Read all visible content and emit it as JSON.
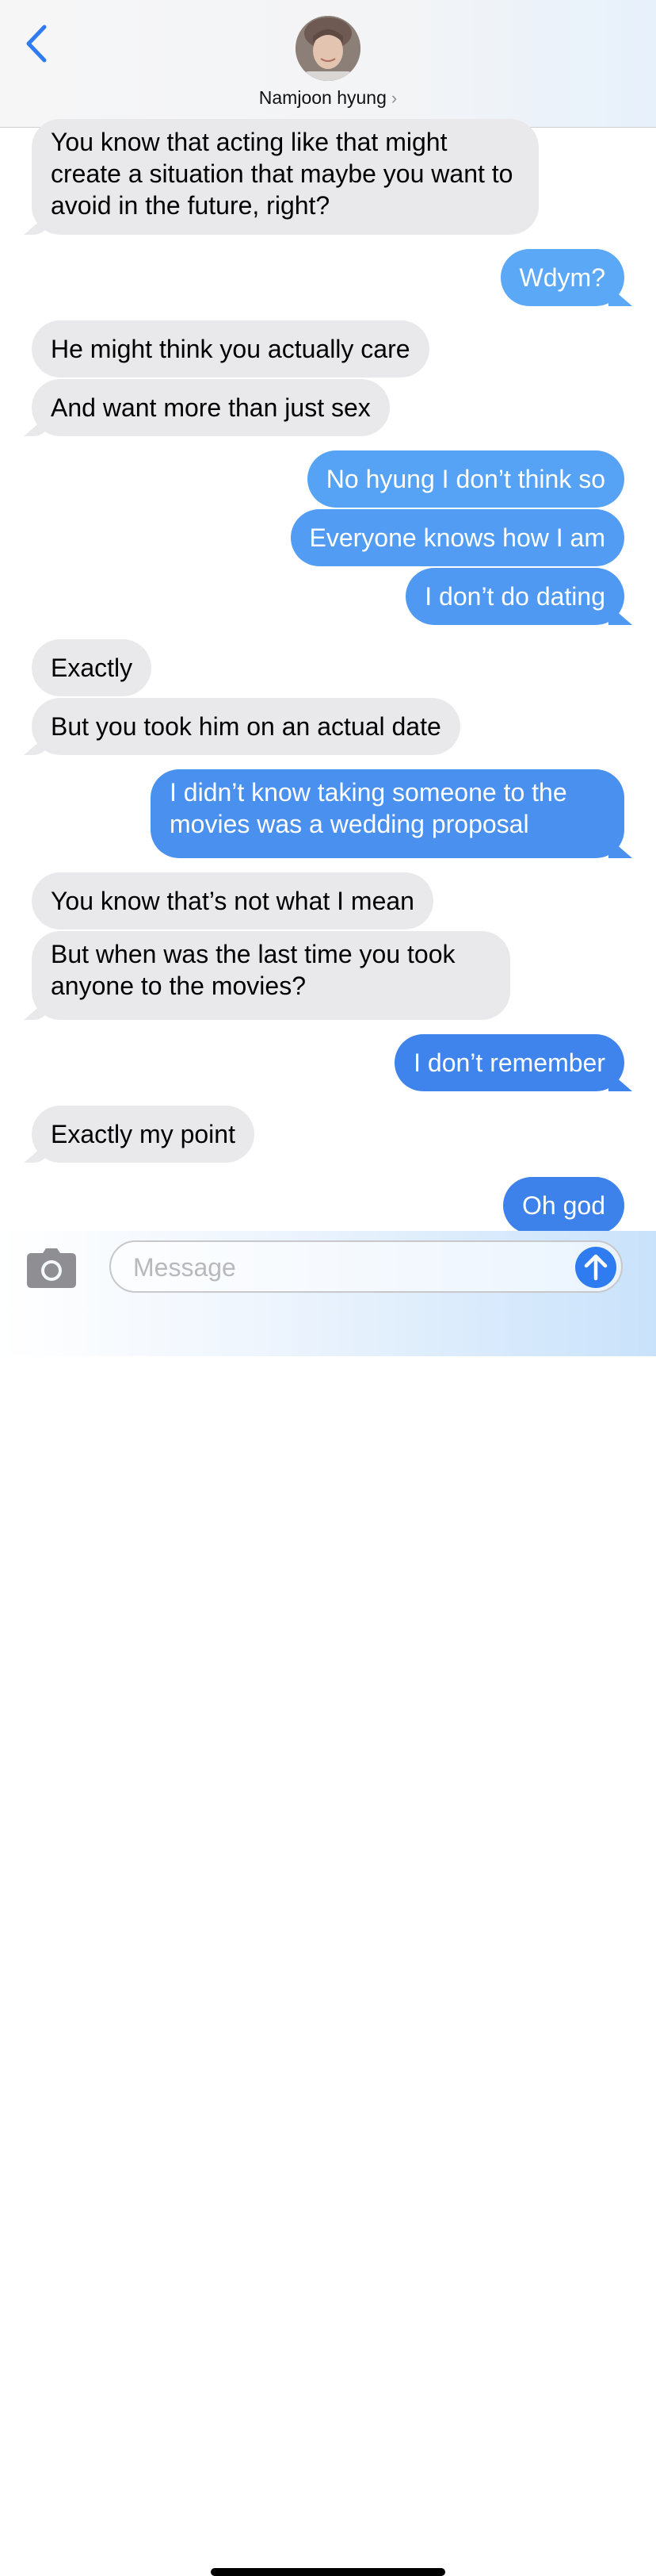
{
  "header": {
    "back_icon": "chevron-left-icon",
    "contact_name": "Namjoon hyung",
    "chevron": "›"
  },
  "messages": [
    {
      "dir": "in",
      "text": "You know that acting like that might create a situation that maybe you want to avoid in the future, right?"
    },
    {
      "dir": "out",
      "text": "Wdym?"
    },
    {
      "dir": "in",
      "text": "He might think you actually care"
    },
    {
      "dir": "in",
      "text": "And want more than just sex"
    },
    {
      "dir": "out",
      "text": "No hyung I don’t think so"
    },
    {
      "dir": "out",
      "text": "Everyone knows how I am"
    },
    {
      "dir": "out",
      "text": "I don’t do dating"
    },
    {
      "dir": "in",
      "text": "Exactly"
    },
    {
      "dir": "in",
      "text": "But you took him on an actual date"
    },
    {
      "dir": "out",
      "text": "I didn’t know taking someone to the movies was a wedding proposal"
    },
    {
      "dir": "in",
      "text": "You know that’s not what I mean"
    },
    {
      "dir": "in",
      "text": "But when was the last time you took anyone to the movies?"
    },
    {
      "dir": "out",
      "text": "I don’t remember"
    },
    {
      "dir": "in",
      "text": "Exactly my point"
    },
    {
      "dir": "out",
      "text": "Oh god"
    }
  ],
  "composer": {
    "camera_icon": "camera-icon",
    "placeholder": "Message",
    "send_icon": "arrow-up-icon"
  },
  "colors": {
    "incoming_bubble": "#e9e9eb",
    "outgoing_bubble": "#4a90ee",
    "accent": "#2f7bf0"
  }
}
